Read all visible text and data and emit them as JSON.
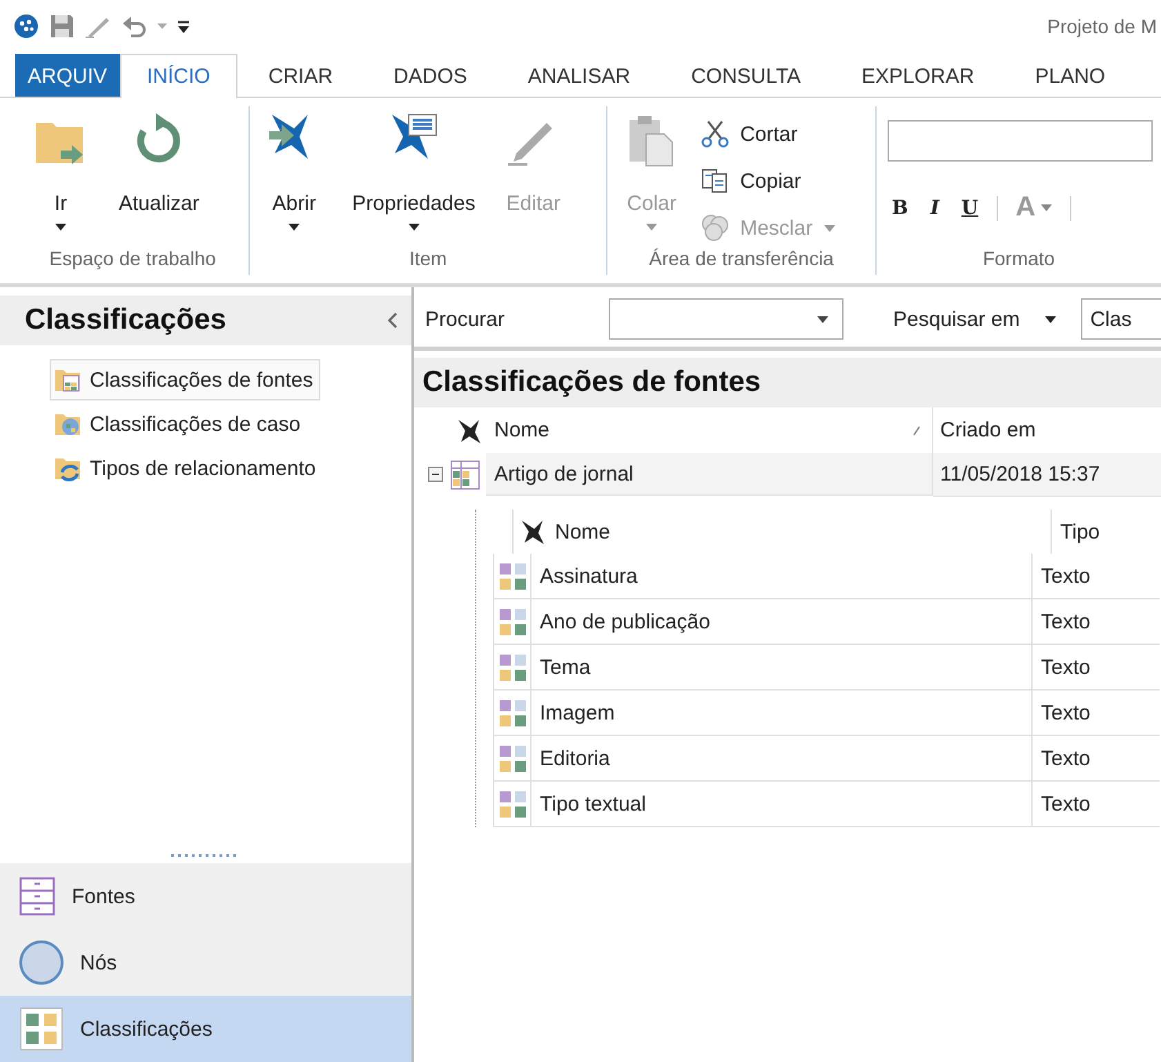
{
  "window": {
    "title": "Projeto de M"
  },
  "tabs": [
    {
      "label": "ARQUIV",
      "kind": "file",
      "selected": false
    },
    {
      "label": "INÍCIO",
      "kind": "tab",
      "selected": true
    },
    {
      "label": "CRIAR",
      "kind": "tab",
      "selected": false
    },
    {
      "label": "DADOS",
      "kind": "tab",
      "selected": false
    },
    {
      "label": "ANALISAR",
      "kind": "tab",
      "selected": false
    },
    {
      "label": "CONSULTA",
      "kind": "tab",
      "selected": false
    },
    {
      "label": "EXPLORAR",
      "kind": "tab",
      "selected": false
    },
    {
      "label": "PLANO",
      "kind": "tab",
      "selected": false
    }
  ],
  "ribbon_groups": [
    {
      "label": "Espaço de trabalho",
      "buttons": [
        {
          "label": "Ir",
          "kind": "go",
          "dropdown": true,
          "disabled": false
        },
        {
          "label": "Atualizar",
          "kind": "refresh",
          "dropdown": false,
          "disabled": false
        }
      ]
    },
    {
      "label": "Item",
      "buttons": [
        {
          "label": "Abrir",
          "kind": "open",
          "dropdown": true,
          "disabled": false
        },
        {
          "label": "Propriedades",
          "kind": "properties",
          "dropdown": true,
          "disabled": false
        },
        {
          "label": "Editar",
          "kind": "edit",
          "dropdown": false,
          "disabled": true
        }
      ]
    },
    {
      "label": "Área de transferência",
      "buttons": [
        {
          "label": "Colar",
          "kind": "paste",
          "dropdown": true,
          "disabled": true
        },
        {
          "label": "Cortar",
          "kind": "cut",
          "dropdown": false,
          "disabled": false
        },
        {
          "label": "Copiar",
          "kind": "copy",
          "dropdown": false,
          "disabled": false
        },
        {
          "label": "Mesclar",
          "kind": "merge",
          "dropdown": true,
          "disabled": true
        }
      ]
    },
    {
      "label": "Formato",
      "buttons": [
        {
          "label": "B",
          "kind": "bold",
          "dropdown": false,
          "disabled": false
        },
        {
          "label": "I",
          "kind": "italic",
          "dropdown": false,
          "disabled": false
        },
        {
          "label": "U",
          "kind": "underline",
          "dropdown": false,
          "disabled": false
        },
        {
          "label": "A",
          "kind": "color",
          "dropdown": true,
          "disabled": false
        }
      ]
    }
  ],
  "sidebar": {
    "title": "Classificações",
    "items": [
      {
        "label": "Classificações de fontes",
        "kind": "source",
        "selected": true
      },
      {
        "label": "Classificações de caso",
        "kind": "case",
        "selected": false
      },
      {
        "label": "Tipos de relacionamento",
        "kind": "relation",
        "selected": false
      }
    ]
  },
  "navigation": [
    {
      "label": "Fontes",
      "kind": "sources",
      "selected": false
    },
    {
      "label": "Nós",
      "kind": "nodes",
      "selected": false
    },
    {
      "label": "Classificações",
      "kind": "classifications",
      "selected": true
    }
  ],
  "search_bar": {
    "label": "Procurar",
    "search_in": "Pesquisar em",
    "search_in_value": "Clas"
  },
  "list": {
    "title": "Classificações de fontes",
    "columns": [
      "Nome",
      "Criado em"
    ],
    "rows": [
      {
        "name": "Artigo de jornal",
        "created": "11/05/2018 15:37",
        "expanded": true,
        "attribute_columns": [
          "Nome",
          "Tipo"
        ],
        "attributes": [
          {
            "name": "Assinatura",
            "type": "Texto"
          },
          {
            "name": "Ano de publicação",
            "type": "Texto"
          },
          {
            "name": "Tema",
            "type": "Texto"
          },
          {
            "name": "Imagem",
            "type": "Texto"
          },
          {
            "name": "Editoria",
            "type": "Texto"
          },
          {
            "name": "Tipo textual",
            "type": "Texto"
          }
        ]
      }
    ]
  }
}
